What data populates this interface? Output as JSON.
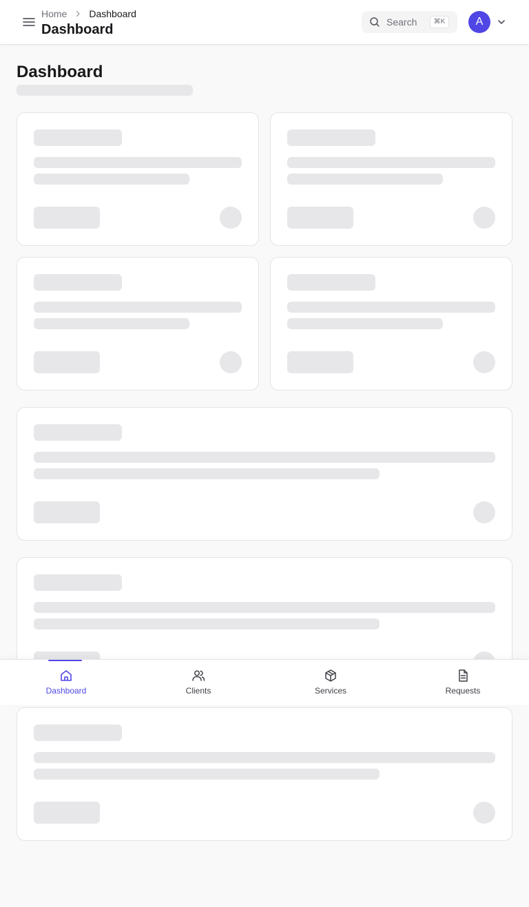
{
  "header": {
    "breadcrumb": {
      "home": "Home",
      "current": "Dashboard"
    },
    "title": "Dashboard",
    "search": {
      "label": "Search",
      "shortcut": "⌘K"
    },
    "avatar_initial": "A"
  },
  "page": {
    "title": "Dashboard"
  },
  "bottom_nav": {
    "items": [
      {
        "label": "Dashboard",
        "icon": "home-icon",
        "active": true
      },
      {
        "label": "Clients",
        "icon": "users-icon",
        "active": false
      },
      {
        "label": "Services",
        "icon": "package-icon",
        "active": false
      },
      {
        "label": "Requests",
        "icon": "document-icon",
        "active": false
      }
    ]
  },
  "colors": {
    "accent": "#4f46e5",
    "skeleton": "#e7e7ea",
    "background": "#f9f9f9",
    "card_border": "#e4e4e7"
  }
}
